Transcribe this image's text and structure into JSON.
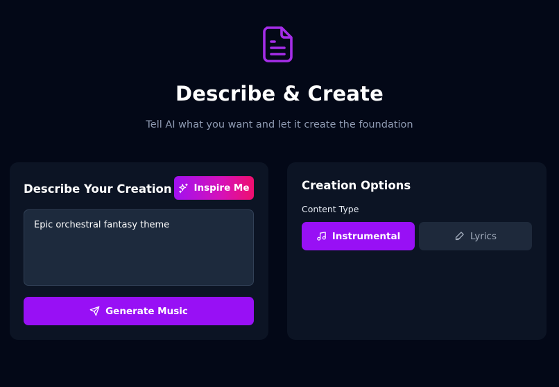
{
  "hero": {
    "title": "Describe & Create",
    "subtitle": "Tell AI what you want and let it create the foundation",
    "icon": "document-icon",
    "accent_color": "#a52de8"
  },
  "describe_card": {
    "title": "Describe Your Creation",
    "inspire_label": "Inspire Me",
    "inspire_icon": "sparkles-icon",
    "prompt_value": "Epic orchestral fantasy theme",
    "generate_label": "Generate Music",
    "generate_icon": "send-icon",
    "button_color": "#9810f5"
  },
  "options_card": {
    "title": "Creation Options",
    "content_type_label": "Content Type",
    "content_types": [
      {
        "label": "Instrumental",
        "icon": "music-note-icon",
        "selected": true
      },
      {
        "label": "Lyrics",
        "icon": "pen-icon",
        "selected": false
      }
    ]
  },
  "colors": {
    "background": "#030817",
    "card": "#0c1424",
    "input": "#1d2a3d",
    "muted_text": "#8f9bb3"
  }
}
